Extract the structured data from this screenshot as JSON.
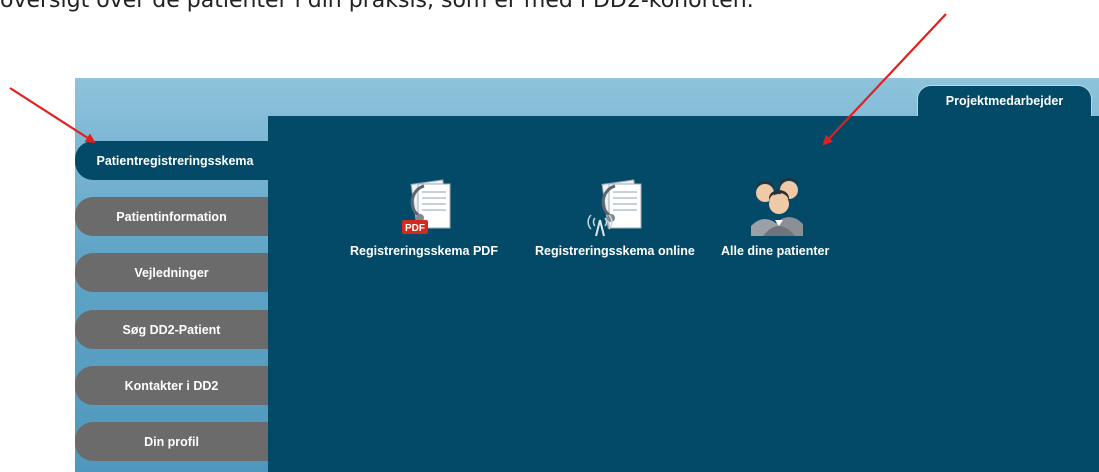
{
  "caption": "oversigt over de patienter i din praksis, som er med i DD2-kohorten.",
  "header_tab": "Projektmedarbejder",
  "sidebar": {
    "items": [
      {
        "label": "Patientregistreringsskema",
        "active": true
      },
      {
        "label": "Patientinformation"
      },
      {
        "label": "Vejledninger"
      },
      {
        "label": "Søg DD2-Patient"
      },
      {
        "label": "Kontakter i DD2"
      },
      {
        "label": "Din profil"
      }
    ]
  },
  "tiles": [
    {
      "label": "Registreringsskema PDF",
      "icon": "stethoscope-document-pdf-icon",
      "badge": "PDF"
    },
    {
      "label": "Registreringsskema online",
      "icon": "stethoscope-document-online-icon"
    },
    {
      "label": "Alle dine patienter",
      "icon": "people-group-icon"
    }
  ],
  "colors": {
    "panel": "#024a68",
    "inactive_tab": "#6b6b6b",
    "arrow": "#e0201f"
  }
}
